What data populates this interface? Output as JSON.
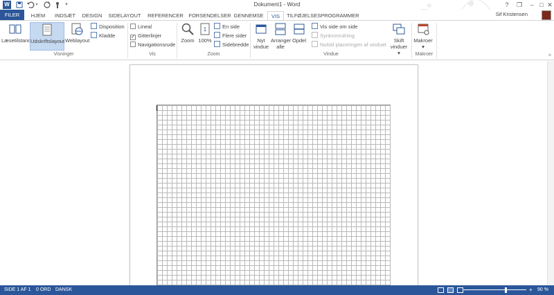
{
  "titlebar": {
    "title": "Dokument1 - Word",
    "app_icon": "W",
    "quick_access": [
      "save-icon",
      "undo-icon",
      "redo-icon",
      "touch-mode-icon",
      "customize-icon"
    ],
    "window_controls": {
      "help": "?",
      "restore": "❐",
      "minimize": "–",
      "maximize": "□",
      "close": "✕"
    }
  },
  "tabs": [
    {
      "label": "FILER"
    },
    {
      "label": "HJEM"
    },
    {
      "label": "INDSÆT"
    },
    {
      "label": "DESIGN"
    },
    {
      "label": "SIDELAYOUT"
    },
    {
      "label": "REFERENCER"
    },
    {
      "label": "FORSENDELSER"
    },
    {
      "label": "GENNEMSE"
    },
    {
      "label": "VIS"
    },
    {
      "label": "TILFØJELSESPROGRAMMER"
    }
  ],
  "user": {
    "name": "Sif Kristensen"
  },
  "ribbon": {
    "visninger": {
      "label": "Visninger",
      "read_mode": "Læsetilstand",
      "print_layout": "Udskriftslayout",
      "web_layout": "Weblayout",
      "outline": "Disposition",
      "draft": "Kladde"
    },
    "vis": {
      "label": "Vis",
      "ruler": "Lineal",
      "gridlines": "Gitterlinjer",
      "nav_pane": "Navigationsrude",
      "gridlines_checked": "✓"
    },
    "zoom": {
      "label": "Zoom",
      "zoom": "Zoom",
      "hundred": "100%",
      "one_page": "En side",
      "multi_page": "Flere sider",
      "page_width": "Sidebredde"
    },
    "vindue": {
      "label": "Vindue",
      "new_window_1": "Nyt",
      "new_window_2": "vindue",
      "arrange_1": "Arranger",
      "arrange_2": "alle",
      "split": "Opdel",
      "side_by_side": "Vis side om side",
      "sync_scroll": "Synkronrulning",
      "reset_pos": "Nulstil placeringen af vinduet",
      "switch_1": "Skift",
      "switch_2": "vinduer ▾"
    },
    "makroer": {
      "label": "Makroer",
      "macros": "Makroer",
      "arrow": "▾"
    }
  },
  "status": {
    "page": "SIDE 1 AF 1",
    "words": "0 ORD",
    "language": "DANSK",
    "minus": "–",
    "plus": "+",
    "zoom": "90 %",
    "zoom_level_percent": 90
  },
  "colors": {
    "accent": "#2b579a",
    "selected": "#c5d9f1"
  }
}
